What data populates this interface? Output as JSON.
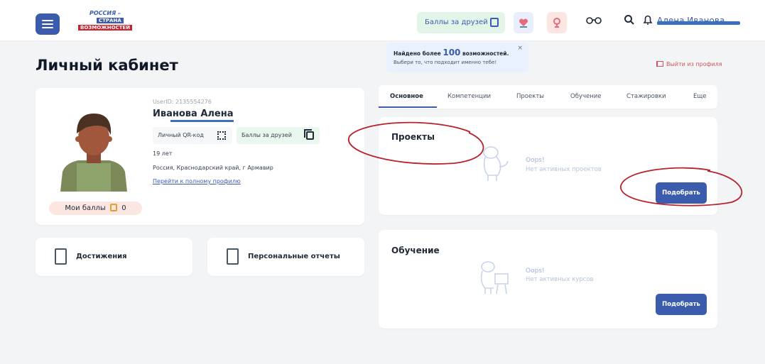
{
  "header": {
    "logo": {
      "line1": "РОССИЯ –",
      "line2": "СТРАНА",
      "line3": "ВОЗМОЖНОСТЕЙ"
    },
    "friends_button": "Баллы за друзей",
    "user_name": "Алена Иванова",
    "icons": [
      "menu-icon",
      "heart-icon",
      "trophy-icon",
      "glasses-icon",
      "search-icon",
      "bell-icon"
    ]
  },
  "tooltip": {
    "line1_before": "Найдено более ",
    "line1_number": "100",
    "line1_after": " возможностей.",
    "line2": "Выбери то, что подходит именно тебе!",
    "close": "×"
  },
  "page": {
    "title": "Личный кабинет",
    "logout": "Выйти из профиля"
  },
  "profile": {
    "user_id": "UserID: 2135554276",
    "name": "Иванова Алена",
    "qr_label": "Личный QR-код",
    "friends_label": "Баллы за друзей",
    "age": "19 лет",
    "location": "Россия, Краснодарский край, г Армавир",
    "full_profile_link": "Перейти к полному профилю",
    "points_label": "Мои баллы",
    "points_value": "0"
  },
  "quick_cards": [
    {
      "label": "Достижения",
      "icon": "certificate-icon"
    },
    {
      "label": "Персональные отчеты",
      "icon": "report-icon"
    }
  ],
  "tabs": [
    "Основное",
    "Компетенции",
    "Проекты",
    "Обучение",
    "Стажировки",
    "Еще"
  ],
  "active_tab": "Основное",
  "projects": {
    "title": "Проекты",
    "empty_title": "Oops!",
    "empty_text": "Нет активных проектов",
    "button": "Подобрать"
  },
  "learning": {
    "title": "Обучение",
    "empty_title": "Oops!",
    "empty_text": "Нет активных курсов",
    "button": "Подобрать"
  },
  "colors": {
    "accent": "#3b5cad",
    "annotation": "#b8222c",
    "friends_bg": "#e3f4e9",
    "tooltip_bg": "#e8f1fc"
  }
}
